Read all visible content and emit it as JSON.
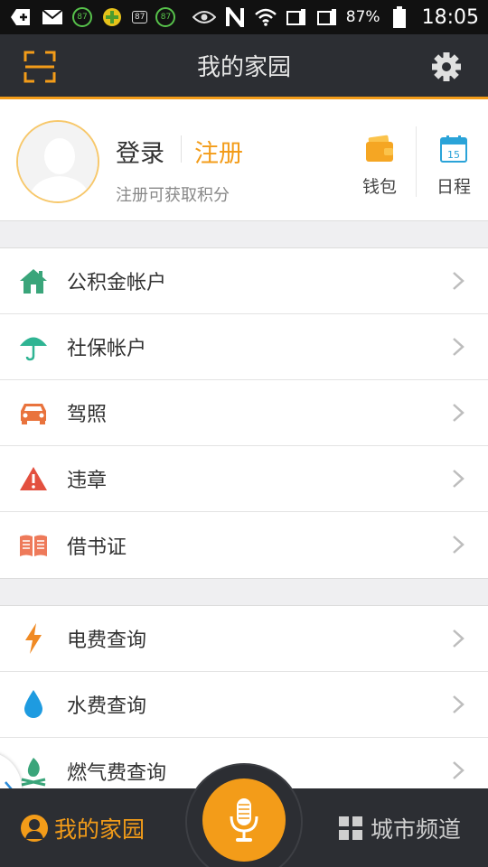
{
  "status_bar": {
    "badges": [
      "87",
      "87",
      "87"
    ],
    "battery": "87%",
    "time": "18:05"
  },
  "header": {
    "title": "我的家园"
  },
  "profile": {
    "login_label": "登录",
    "register_label": "注册",
    "hint": "注册可获取积分",
    "wallet_label": "钱包",
    "schedule_label": "日程",
    "calendar_day": "15"
  },
  "groups": [
    [
      {
        "label": "公积金帐户",
        "icon": "house-icon",
        "color": "#3aa57a"
      },
      {
        "label": "社保帐户",
        "icon": "umbrella-icon",
        "color": "#2fb493"
      },
      {
        "label": "驾照",
        "icon": "car-icon",
        "color": "#e9733d"
      },
      {
        "label": "违章",
        "icon": "warning-icon",
        "color": "#e3503f"
      },
      {
        "label": "借书证",
        "icon": "book-icon",
        "color": "#ee7a5a"
      }
    ],
    [
      {
        "label": "电费查询",
        "icon": "lightning-icon",
        "color": "#f08a24"
      },
      {
        "label": "水费查询",
        "icon": "water-drop-icon",
        "color": "#1e9be0"
      },
      {
        "label": "燃气费查询",
        "icon": "flame-icon",
        "color": "#3aa57a"
      }
    ]
  ],
  "bottom_bar": {
    "home_label": "我的家园",
    "city_label": "城市频道"
  },
  "colors": {
    "accent": "#f39c19",
    "header_bg": "#2c2e33"
  }
}
